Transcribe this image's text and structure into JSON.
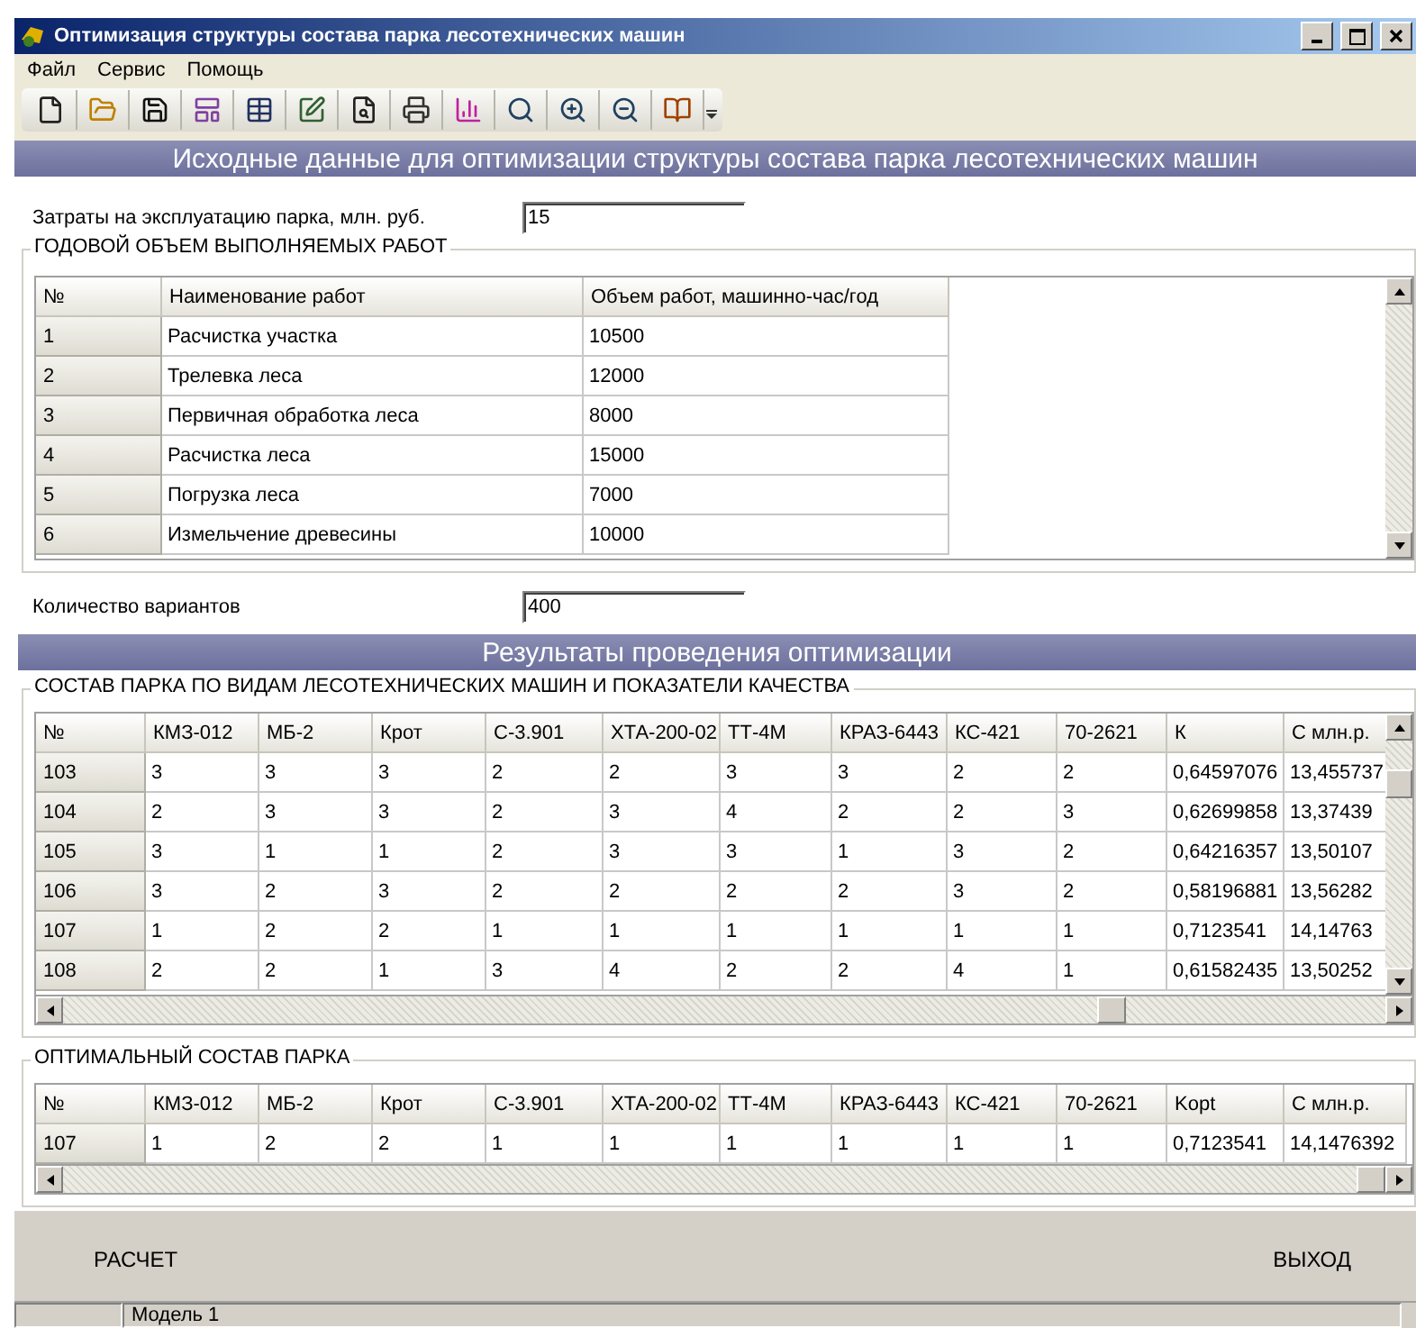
{
  "window": {
    "title": "Оптимизация структуры состава парка лесотехнических машин"
  },
  "menu": [
    "Файл",
    "Сервис",
    "Помощь"
  ],
  "input_header": "Исходные данные для оптимизации структуры состава парка лесотехнических машин",
  "cost_field": {
    "label": "Затраты на эксплуатацию парка, млн. руб.",
    "value": "15"
  },
  "works_group": {
    "title": "ГОДОВОЙ ОБЪЕМ ВЫПОЛНЯЕМЫХ РАБОТ",
    "columns": [
      "№",
      "Наименование работ",
      "Объем работ, машинно-час/год"
    ],
    "rows": [
      [
        "1",
        "Расчистка участка",
        "10500"
      ],
      [
        "2",
        "Трелевка леса",
        "12000"
      ],
      [
        "3",
        "Первичная обработка леса",
        "8000"
      ],
      [
        "4",
        "Расчистка леса",
        "15000"
      ],
      [
        "5",
        "Погрузка леса",
        "7000"
      ],
      [
        "6",
        "Измельчение древесины",
        "10000"
      ]
    ]
  },
  "variants_field": {
    "label": "Количество вариантов",
    "value": "400"
  },
  "results_header": "Результаты проведения оптимизации",
  "composition_group": {
    "title": "СОСТАВ ПАРКА ПО ВИДАМ ЛЕСОТЕХНИЧЕСКИХ МАШИН И ПОКАЗАТЕЛИ КАЧЕСТВА",
    "columns": [
      "№",
      "КМЗ-012",
      "МБ-2",
      "Крот",
      "С-3.901",
      "ХТА-200-02",
      "ТТ-4М",
      "КРАЗ-6443",
      "КС-421",
      "70-2621",
      "К",
      "С млн.р."
    ],
    "rows": [
      [
        "103",
        "3",
        "3",
        "3",
        "2",
        "2",
        "3",
        "3",
        "2",
        "2",
        "0,64597076",
        "13,455737"
      ],
      [
        "104",
        "2",
        "3",
        "3",
        "2",
        "3",
        "4",
        "2",
        "2",
        "3",
        "0,62699858",
        "13,37439"
      ],
      [
        "105",
        "3",
        "1",
        "1",
        "2",
        "3",
        "3",
        "1",
        "3",
        "2",
        "0,64216357",
        "13,50107"
      ],
      [
        "106",
        "3",
        "2",
        "3",
        "2",
        "2",
        "2",
        "2",
        "3",
        "2",
        "0,58196881",
        "13,56282"
      ],
      [
        "107",
        "1",
        "2",
        "2",
        "1",
        "1",
        "1",
        "1",
        "1",
        "1",
        "0,7123541",
        "14,14763"
      ],
      [
        "108",
        "2",
        "2",
        "1",
        "3",
        "4",
        "2",
        "2",
        "4",
        "1",
        "0,61582435",
        "13,50252"
      ]
    ]
  },
  "optimal_group": {
    "title": "ОПТИМАЛЬНЫЙ СОСТАВ ПАРКА",
    "columns": [
      "№",
      "КМЗ-012",
      "МБ-2",
      "Крот",
      "С-3.901",
      "ХТА-200-02",
      "ТТ-4М",
      "КРАЗ-6443",
      "КС-421",
      "70-2621",
      "Kopt",
      "С млн.р."
    ],
    "rows": [
      [
        "107",
        "1",
        "2",
        "2",
        "1",
        "1",
        "1",
        "1",
        "1",
        "1",
        "0,7123541",
        "14,1476392"
      ]
    ]
  },
  "buttons": [
    "РАСЧЕТ",
    "ВЫХОД"
  ],
  "status_bar": [
    "Модель 1"
  ]
}
